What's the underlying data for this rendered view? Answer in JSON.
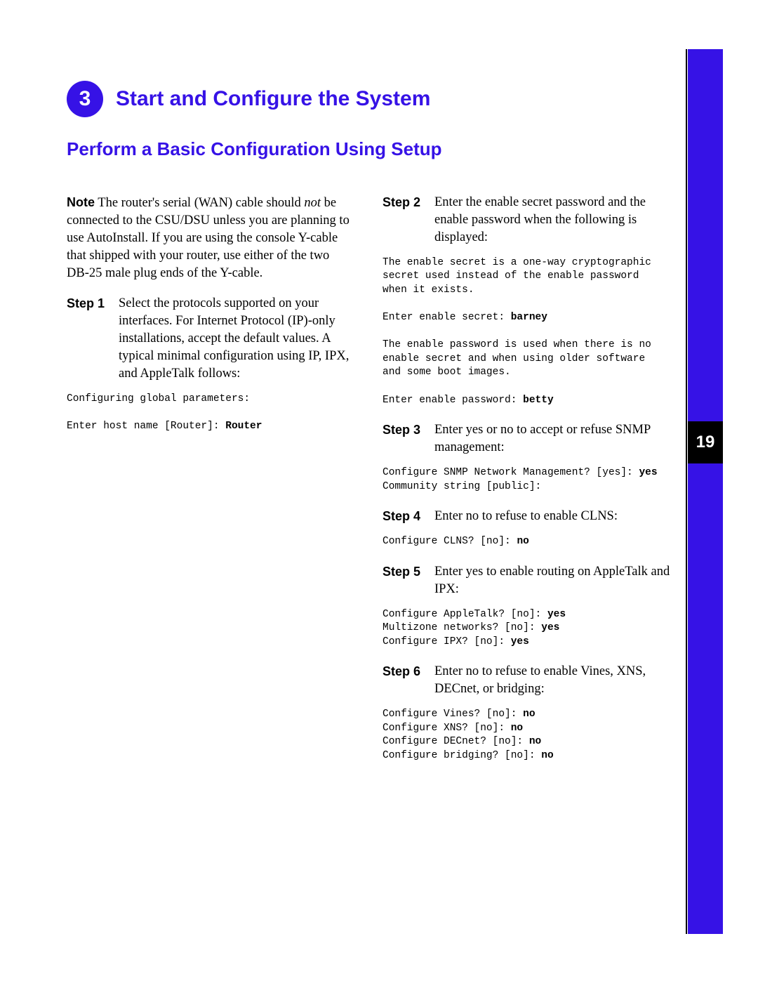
{
  "page_number": "19",
  "section_number": "3",
  "section_title": "Start and Configure the System",
  "subsection_title": "Perform a Basic Configuration Using Setup",
  "note_label": "Note",
  "note_body_pre": "The router's serial (WAN) cable should ",
  "note_body_em": "not",
  "note_body_post": " be connected to the CSU/DSU unless you are planning to use AutoInstall. If you are using the console Y-cable that shipped with your router, use either of the two DB-25 male plug ends of the Y-cable.",
  "steps": {
    "s1": {
      "label": "Step 1",
      "text": "Select the protocols supported on your interfaces. For Internet Protocol (IP)-only installations, accept the default values. A typical minimal configuration using IP, IPX, and AppleTalk follows:"
    },
    "s2": {
      "label": "Step 2",
      "text": "Enter the enable secret password and the enable password when the following is displayed:"
    },
    "s3": {
      "label": "Step 3",
      "text": "Enter yes or no to accept or refuse SNMP management:"
    },
    "s4": {
      "label": "Step 4",
      "text": "Enter no to refuse to enable CLNS:"
    },
    "s5": {
      "label": "Step 5",
      "text": "Enter yes to enable routing on AppleTalk and IPX:"
    },
    "s6": {
      "label": "Step 6",
      "text": "Enter no to refuse to enable Vines, XNS, DECnet, or bridging:"
    }
  },
  "cli": {
    "c1a": "Configuring global parameters:",
    "c1b_prompt": "Enter host name [Router]: ",
    "c1b_value": "Router",
    "c2a": "The enable secret is a one-way cryptographic\nsecret used instead of the enable password\nwhen it exists.",
    "c2b_prompt": "Enter enable secret: ",
    "c2b_value": "barney",
    "c2c": "The enable password is used when there is no\nenable secret and when using older software\nand some boot images.",
    "c2d_prompt": "Enter enable password: ",
    "c2d_value": "betty",
    "c3a_prompt": "Configure SNMP Network Management? [yes]: ",
    "c3a_value": "yes",
    "c3b": "Community string [public]:",
    "c4_prompt": "Configure CLNS? [no]: ",
    "c4_value": "no",
    "c5a_prompt": "Configure AppleTalk? [no]: ",
    "c5a_value": "yes",
    "c5b_prompt": "Multizone networks? [no]: ",
    "c5b_value": "yes",
    "c5c_prompt": "Configure IPX? [no]: ",
    "c5c_value": "yes",
    "c6a_prompt": "Configure Vines? [no]: ",
    "c6a_value": "no",
    "c6b_prompt": "Configure XNS? [no]: ",
    "c6b_value": "no",
    "c6c_prompt": "Configure DECnet? [no]: ",
    "c6c_value": "no",
    "c6d_prompt": "Configure bridging? [no]: ",
    "c6d_value": "no"
  }
}
